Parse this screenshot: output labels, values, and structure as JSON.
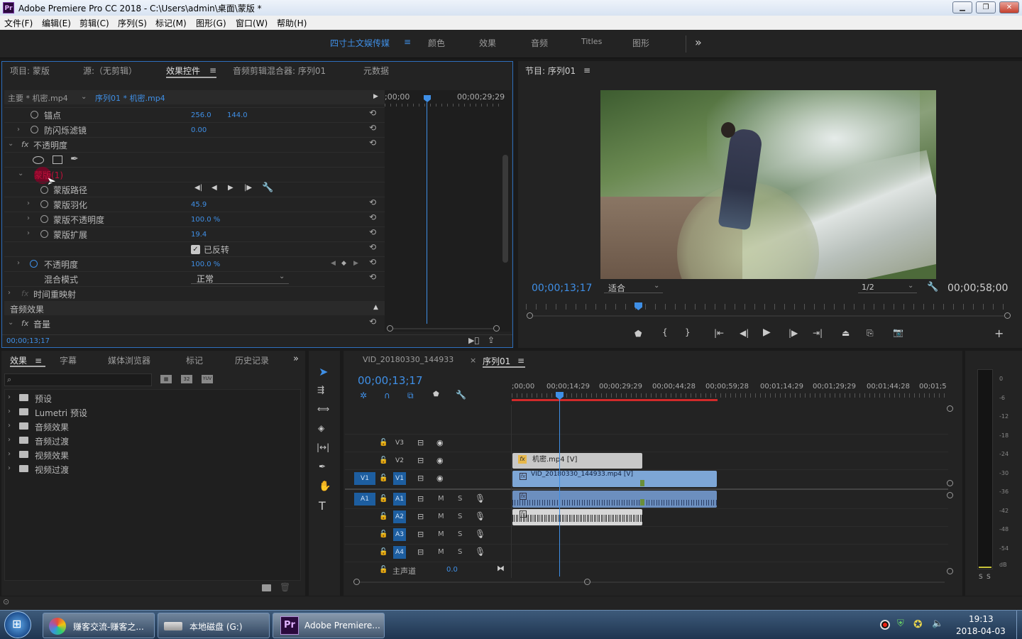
{
  "window": {
    "title": "Adobe Premiere Pro CC 2018 - C:\\Users\\admin\\桌面\\蒙版 *",
    "app_icon": "Pr",
    "controls": [
      "minimize-icon",
      "restore-icon",
      "close-icon"
    ]
  },
  "menu": [
    "文件(F)",
    "编辑(E)",
    "剪辑(C)",
    "序列(S)",
    "标记(M)",
    "图形(G)",
    "窗口(W)",
    "帮助(H)"
  ],
  "workspaces": {
    "items": [
      "四寸土文娱传媒",
      "颜色",
      "效果",
      "音频",
      "Titles",
      "图形"
    ],
    "active": "四寸土文娱传媒",
    "more": "»"
  },
  "source_panel": {
    "tabs": [
      "项目: 蒙版",
      "源:（无剪辑）",
      "效果控件",
      "音频剪辑混合器: 序列01",
      "元数据"
    ],
    "active_tab": "效果控件",
    "clip_master": "主要 * 机密.mp4",
    "clip_seq": "序列01 * 机密.mp4",
    "time_start": ";00;00",
    "time_end": "00;00;29;29",
    "timecode": "00;00;13;17",
    "anchor_label": "锚点",
    "anchor_x": "256.0",
    "anchor_y": "144.0",
    "flicker_label": "防闪烁滤镜",
    "flicker_val": "0.00",
    "opacity_fx": "不透明度",
    "mask_name": "蒙版(1)",
    "mask_path": "蒙版路径",
    "mask_feather": "蒙版羽化",
    "mask_feather_val": "45.9",
    "mask_opacity": "蒙版不透明度",
    "mask_opacity_val": "100.0 %",
    "mask_expand": "蒙版扩展",
    "mask_expand_val": "19.4",
    "inverted_label": "已反转",
    "opacity_label": "不透明度",
    "opacity_val": "100.0 %",
    "blend_label": "混合模式",
    "blend_val": "正常",
    "time_remap": "时间重映射",
    "audio_fx": "音频效果",
    "volume": "音量"
  },
  "program_monitor": {
    "title": "节目: 序列01",
    "timecode": "00;00;13;17",
    "fit": "适合",
    "resolution": "1/2",
    "duration": "00;00;58;00"
  },
  "effects_panel": {
    "tabs": [
      "效果",
      "字幕",
      "媒体浏览器",
      "标记",
      "历史记录"
    ],
    "active_tab": "效果",
    "search_placeholder": "",
    "badges": [
      "32",
      "YUV"
    ],
    "folders": [
      "预设",
      "Lumetri 预设",
      "音频效果",
      "音频过渡",
      "视频效果",
      "视频过渡"
    ]
  },
  "timeline": {
    "tabs": [
      "VID_20180330_144933",
      "序列01"
    ],
    "active_tab": "序列01",
    "timecode": "00;00;13;17",
    "ruler": [
      ";00;00",
      "00;00;14;29",
      "00;00;29;29",
      "00;00;44;28",
      "00;00;59;28",
      "00;01;14;29",
      "00;01;29;29",
      "00;01;44;28",
      "00;01;5"
    ],
    "video_tracks": [
      "V3",
      "V2",
      "V1"
    ],
    "audio_tracks": [
      "A1",
      "A2",
      "A3",
      "A4"
    ],
    "source_v": "V1",
    "source_a": "A1",
    "master_label": "主声道",
    "master_val": "0.0",
    "clip_v2": "机密.mp4 [V]",
    "clip_v1": "VID_20180330_144933.mp4 [V]",
    "m": "M",
    "s": "S"
  },
  "meter": {
    "ticks": [
      "0",
      "-6",
      "-12",
      "-18",
      "-24",
      "-30",
      "-36",
      "-42",
      "-48",
      "-54",
      "dB"
    ],
    "solo": [
      "S",
      "S"
    ]
  },
  "taskbar": {
    "items": [
      "赚客交流-赚客之...",
      "本地磁盘 (G:)",
      "Adobe Premiere..."
    ],
    "time": "19:13",
    "date": "2018-04-03"
  }
}
